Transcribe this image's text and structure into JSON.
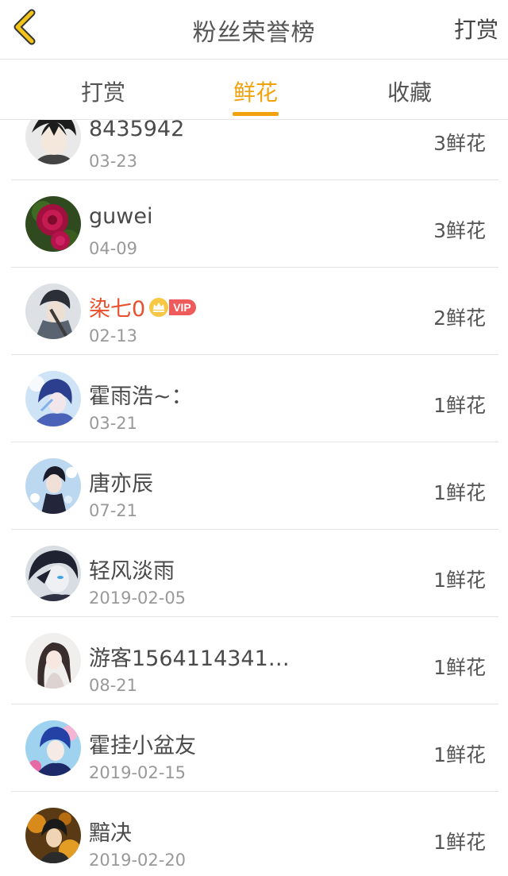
{
  "header": {
    "title": "粉丝荣誉榜",
    "action_label": "打赏",
    "back_icon": "chevron-left-icon",
    "back_color": "#f2c318"
  },
  "tabs": [
    {
      "label": "打赏",
      "active": false
    },
    {
      "label": "鲜花",
      "active": true
    },
    {
      "label": "收藏",
      "active": false
    }
  ],
  "colors": {
    "accent": "#f2a20c",
    "vip_name": "#e8502e",
    "vip_badge": "#ef5a5a",
    "text": "#4a4a4a",
    "subtext": "#999999"
  },
  "fans": [
    {
      "name": "8435942",
      "date": "03-23",
      "amount": "3鲜花",
      "vip": false
    },
    {
      "name": "guwei",
      "date": "04-09",
      "amount": "3鲜花",
      "vip": false
    },
    {
      "name": "染七0",
      "date": "02-13",
      "amount": "2鲜花",
      "vip": true,
      "badge": "VIP"
    },
    {
      "name": "霍雨浩~：",
      "date": "03-21",
      "amount": "1鲜花",
      "vip": false
    },
    {
      "name": "唐亦辰",
      "date": "07-21",
      "amount": "1鲜花",
      "vip": false
    },
    {
      "name": "轻风淡雨",
      "date": "2019-02-05",
      "amount": "1鲜花",
      "vip": false
    },
    {
      "name": "游客1564114341…",
      "date": "08-21",
      "amount": "1鲜花",
      "vip": false
    },
    {
      "name": "霍挂小盆友",
      "date": "2019-02-15",
      "amount": "1鲜花",
      "vip": false
    },
    {
      "name": "黯决",
      "date": "2019-02-20",
      "amount": "1鲜花",
      "vip": false
    }
  ]
}
